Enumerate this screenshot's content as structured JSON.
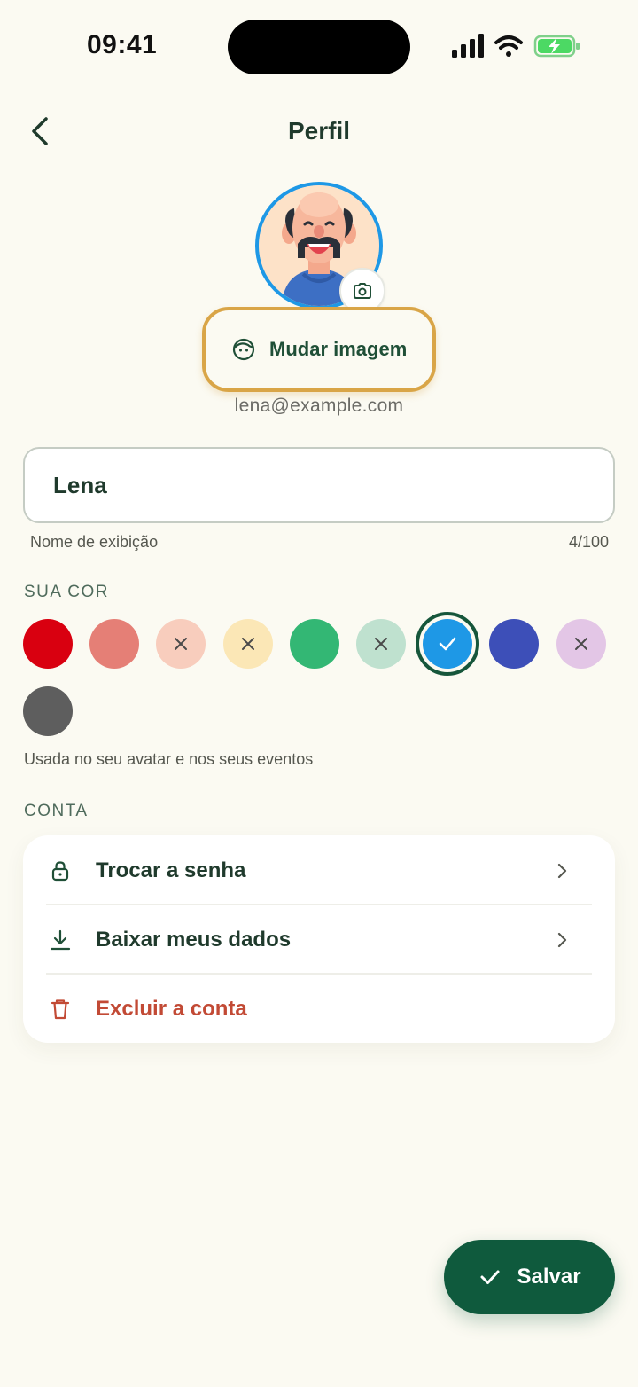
{
  "status_bar": {
    "time": "09:41"
  },
  "header": {
    "title": "Perfil"
  },
  "profile": {
    "change_image_label": "Mudar imagem",
    "email": "lena@example.com"
  },
  "name_field": {
    "value": "Lena",
    "helper": "Nome de exibição",
    "counter": "4/100"
  },
  "color_section": {
    "title": "SUA COR",
    "caption": "Usada no seu avatar e nos seus eventos",
    "swatches": [
      {
        "color": "#d90010",
        "state": "available"
      },
      {
        "color": "#e57f76",
        "state": "available"
      },
      {
        "color": "#f8cdbd",
        "state": "unavailable"
      },
      {
        "color": "#fbe7b6",
        "state": "unavailable"
      },
      {
        "color": "#33b774",
        "state": "available"
      },
      {
        "color": "#bfe1cf",
        "state": "unavailable"
      },
      {
        "color": "#1e98e6",
        "state": "selected"
      },
      {
        "color": "#3d4fb8",
        "state": "available"
      },
      {
        "color": "#e3c6e6",
        "state": "unavailable"
      },
      {
        "color": "#5e5e5e",
        "state": "available"
      }
    ]
  },
  "account_section": {
    "title": "CONTA",
    "items": [
      {
        "label": "Trocar a senha",
        "icon": "lock-icon"
      },
      {
        "label": "Baixar meus dados",
        "icon": "download-icon"
      },
      {
        "label": "Excluir a conta",
        "icon": "trash-icon",
        "color": "#c24a35"
      }
    ]
  },
  "save_button": {
    "label": "Salvar"
  },
  "colors": {
    "accent": "#0f5a3d",
    "highlight": "#d9a547",
    "danger": "#c24a35",
    "background": "#fbfaf2"
  }
}
